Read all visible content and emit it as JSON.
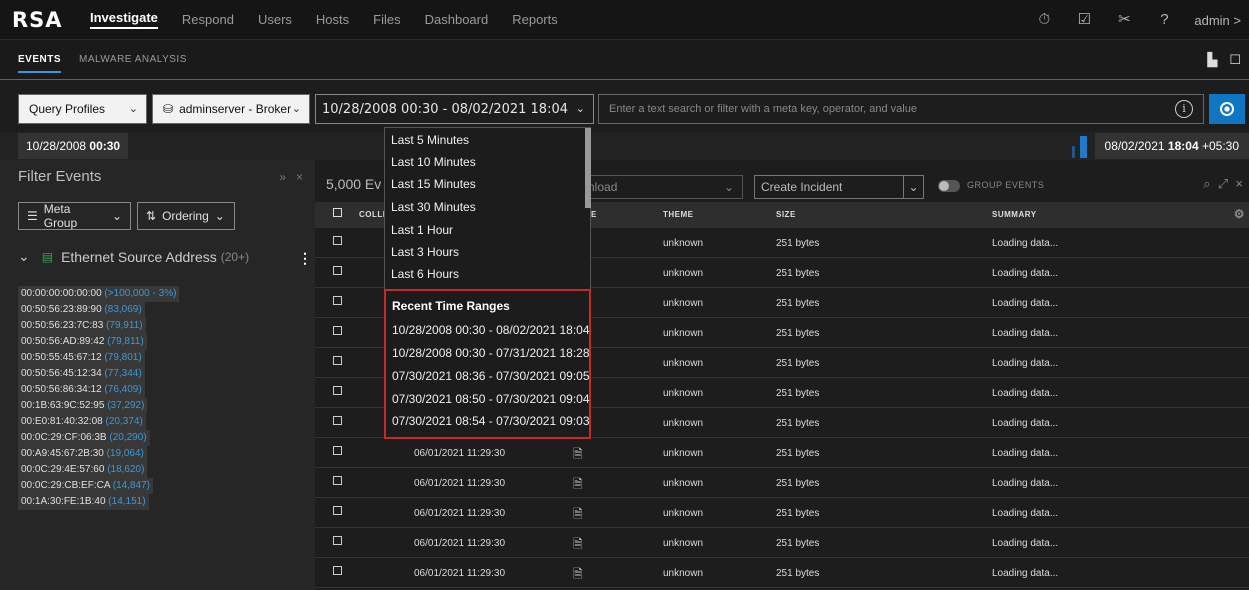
{
  "topnav": {
    "logo": "RSA",
    "items": [
      "Investigate",
      "Respond",
      "Users",
      "Hosts",
      "Files",
      "Dashboard",
      "Reports"
    ],
    "admin": "admin >"
  },
  "subnav": {
    "tabs": [
      "EVENTS",
      "MALWARE ANALYSIS"
    ]
  },
  "query": {
    "profiles": "Query Profiles",
    "service": "adminserver - Broker",
    "date_range": "10/28/2008 00:30  -  08/02/2021 18:04",
    "search_placeholder": "Enter a text search or filter with a meta key, operator, and value"
  },
  "timeline": {
    "start_date": "10/28/2008 ",
    "start_time": "00:30",
    "end_date": "08/02/2021 ",
    "end_time": "18:04",
    "end_tz": " +05:30"
  },
  "filter": {
    "title": "Filter Events",
    "meta_group": "Meta Group",
    "ordering": "Ordering",
    "section_name": "Ethernet Source Address",
    "section_count": "(20+)",
    "values": [
      {
        "v": "00:00:00:00:00:00",
        "c": "(>100,000 - 3%)"
      },
      {
        "v": "00:50:56:23:89:90",
        "c": "(83,069)"
      },
      {
        "v": "00:50:56:23:7C:83",
        "c": "(79,911)"
      },
      {
        "v": "00:50:56:AD:89:42",
        "c": "(79,811)"
      },
      {
        "v": "00:50:55:45:67:12",
        "c": "(79,801)"
      },
      {
        "v": "00:50:56:45:12:34",
        "c": "(77,344)"
      },
      {
        "v": "00:50:56:86:34:12",
        "c": "(76,409)"
      },
      {
        "v": "00:1B:63:9C:52:95",
        "c": "(37,292)"
      },
      {
        "v": "00:E0:81:40:32:08",
        "c": "(20,374)"
      },
      {
        "v": "00:0C:29:CF:06:3B",
        "c": "(20,290)"
      },
      {
        "v": "00:A9:45:67:2B:30",
        "c": "(19,064)"
      },
      {
        "v": "00:0C:29:4E:57:60",
        "c": "(18,620)"
      },
      {
        "v": "00:0C:29:CB:EF:CA",
        "c": "(14,847)"
      },
      {
        "v": "00:1A:30:FE:1B:40",
        "c": "(14,151)"
      }
    ]
  },
  "events": {
    "count": "5,000 Ev",
    "download": "nload",
    "create_incident": "Create Incident",
    "group_events": "GROUP EVENTS",
    "columns": [
      "COLLE",
      "E",
      "THEME",
      "SIZE",
      "SUMMARY"
    ],
    "rows": [
      {
        "time": "",
        "theme": "unknown",
        "size": "251 bytes",
        "summary": "Loading data..."
      },
      {
        "time": "",
        "theme": "unknown",
        "size": "251 bytes",
        "summary": "Loading data..."
      },
      {
        "time": "",
        "theme": "unknown",
        "size": "251 bytes",
        "summary": "Loading data..."
      },
      {
        "time": "",
        "theme": "unknown",
        "size": "251 bytes",
        "summary": "Loading data..."
      },
      {
        "time": "",
        "theme": "unknown",
        "size": "251 bytes",
        "summary": "Loading data..."
      },
      {
        "time": "",
        "theme": "unknown",
        "size": "251 bytes",
        "summary": "Loading data..."
      },
      {
        "time": "",
        "theme": "unknown",
        "size": "251 bytes",
        "summary": "Loading data..."
      },
      {
        "time": "06/01/2021 11:29:30",
        "theme": "unknown",
        "size": "251 bytes",
        "summary": "Loading data..."
      },
      {
        "time": "06/01/2021 11:29:30",
        "theme": "unknown",
        "size": "251 bytes",
        "summary": "Loading data..."
      },
      {
        "time": "06/01/2021 11:29:30",
        "theme": "unknown",
        "size": "251 bytes",
        "summary": "Loading data..."
      },
      {
        "time": "06/01/2021 11:29:30",
        "theme": "unknown",
        "size": "251 bytes",
        "summary": "Loading data..."
      },
      {
        "time": "06/01/2021 11:29:30",
        "theme": "unknown",
        "size": "251 bytes",
        "summary": "Loading data..."
      }
    ]
  },
  "dropdown": {
    "items": [
      "Last 5 Minutes",
      "Last 10 Minutes",
      "Last 15 Minutes",
      "Last 30 Minutes",
      "Last 1 Hour",
      "Last 3 Hours",
      "Last 6 Hours"
    ],
    "recent_header": "Recent Time Ranges",
    "recent": [
      "10/28/2008 00:30 - 08/02/2021 18:04",
      "10/28/2008 00:30 - 07/31/2021 18:28",
      "07/30/2021 08:36 - 07/30/2021 09:05",
      "07/30/2021 08:50 - 07/30/2021 09:04",
      "07/30/2021 08:54 - 07/30/2021 09:03"
    ]
  },
  "colors": {
    "accent": "#0e76c2",
    "highlight_border": "#c62a2a",
    "count_blue": "#3a9ad9"
  },
  "icons": [
    "timer-icon",
    "checklist-icon",
    "tools-icon",
    "help-icon",
    "database-icon",
    "network-icon",
    "document-icon",
    "info-icon"
  ]
}
